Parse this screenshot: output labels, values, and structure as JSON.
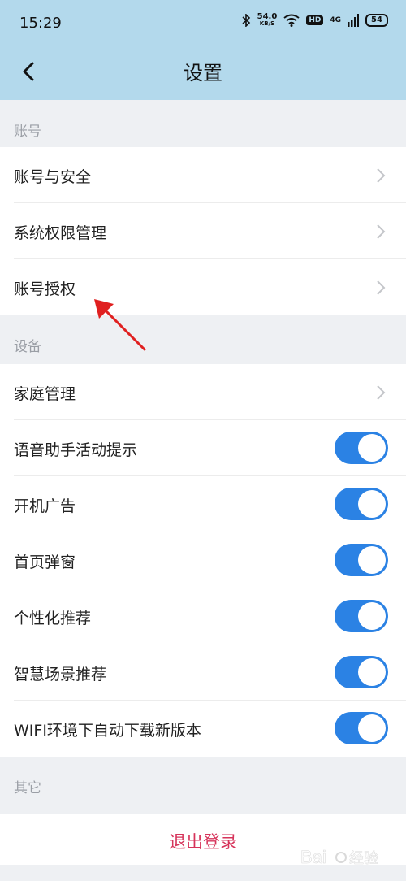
{
  "status_bar": {
    "time": "15:29",
    "speed_value": "54.0",
    "speed_unit": "KB/S",
    "hd_label": "HD",
    "network_label": "4G",
    "battery_level": "54"
  },
  "navbar": {
    "title": "设置"
  },
  "sections": {
    "account": {
      "header": "账号"
    },
    "device": {
      "header": "设备"
    },
    "other": {
      "header": "其它"
    }
  },
  "account_items": [
    {
      "label": "账号与安全"
    },
    {
      "label": "系统权限管理"
    },
    {
      "label": "账号授权"
    }
  ],
  "device_items": [
    {
      "label": "家庭管理"
    },
    {
      "label": "语音助手活动提示",
      "toggle_on": true
    },
    {
      "label": "开机广告",
      "toggle_on": true
    },
    {
      "label": "首页弹窗",
      "toggle_on": true
    },
    {
      "label": "个性化推荐",
      "toggle_on": true
    },
    {
      "label": "智慧场景推荐",
      "toggle_on": true
    },
    {
      "label": "WIFI环境下自动下载新版本",
      "toggle_on": true
    }
  ],
  "logout": {
    "label": "退出登录"
  },
  "colors": {
    "header_bg": "#b3d9ec",
    "toggle_on": "#2b82e4",
    "logout_text": "#d6335a",
    "arrow": "#e02020"
  }
}
